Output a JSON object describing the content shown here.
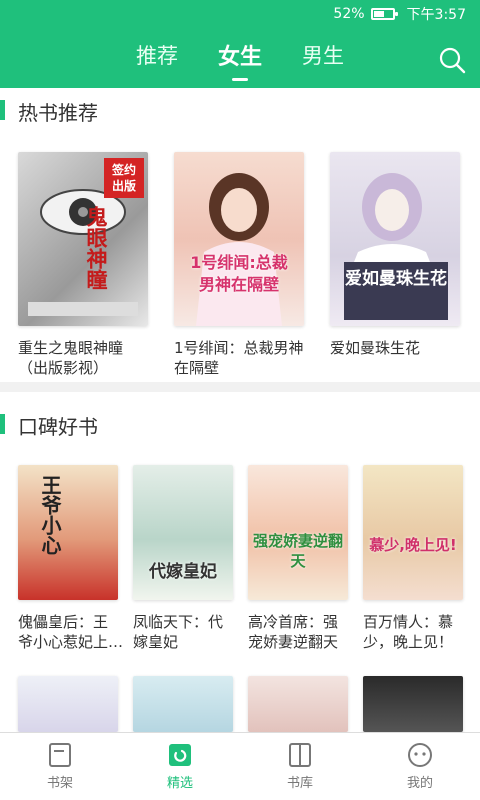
{
  "status": {
    "battery": "52%",
    "battery_level": 0.52,
    "time": "下午3:57"
  },
  "tabs": [
    {
      "label": "推荐",
      "active": false
    },
    {
      "label": "女生",
      "active": true
    },
    {
      "label": "男生",
      "active": false
    }
  ],
  "hot_section": {
    "title": "热书推荐",
    "books": [
      {
        "title_line1": "重生之鬼眼神瞳",
        "title_line2": "（出版影视）",
        "cover_text": "鬼眼神瞳",
        "badge": "签约\n出版"
      },
      {
        "title_line1": "1号绯闻：总裁男神",
        "title_line2": "在隔壁",
        "cover_text": "1号绯闻:总裁男神在隔壁"
      },
      {
        "title_line1": "爱如曼珠生花",
        "title_line2": "",
        "cover_text": "爱如曼珠生花"
      }
    ]
  },
  "praise_section": {
    "title": "口碑好书",
    "books": [
      {
        "title_line1": "傀儡皇后：王",
        "title_line2": "爷小心惹妃上…",
        "cover_text": "王爷小心"
      },
      {
        "title_line1": "凤临天下：代",
        "title_line2": "嫁皇妃",
        "cover_text": "代嫁皇妃"
      },
      {
        "title_line1": "高冷首席：强",
        "title_line2": "宠娇妻逆翻天",
        "cover_text": "强宠娇妻逆翻天"
      },
      {
        "title_line1": "百万情人：慕",
        "title_line2": "少，晚上见！",
        "cover_text": "慕少,晚上见!"
      }
    ]
  },
  "bottom_nav": [
    {
      "label": "书架",
      "icon": "bookshelf-icon",
      "active": false
    },
    {
      "label": "精选",
      "icon": "featured-icon",
      "active": true
    },
    {
      "label": "书库",
      "icon": "library-icon",
      "active": false
    },
    {
      "label": "我的",
      "icon": "profile-icon",
      "active": false
    }
  ],
  "colors": {
    "accent": "#1fc07c"
  }
}
